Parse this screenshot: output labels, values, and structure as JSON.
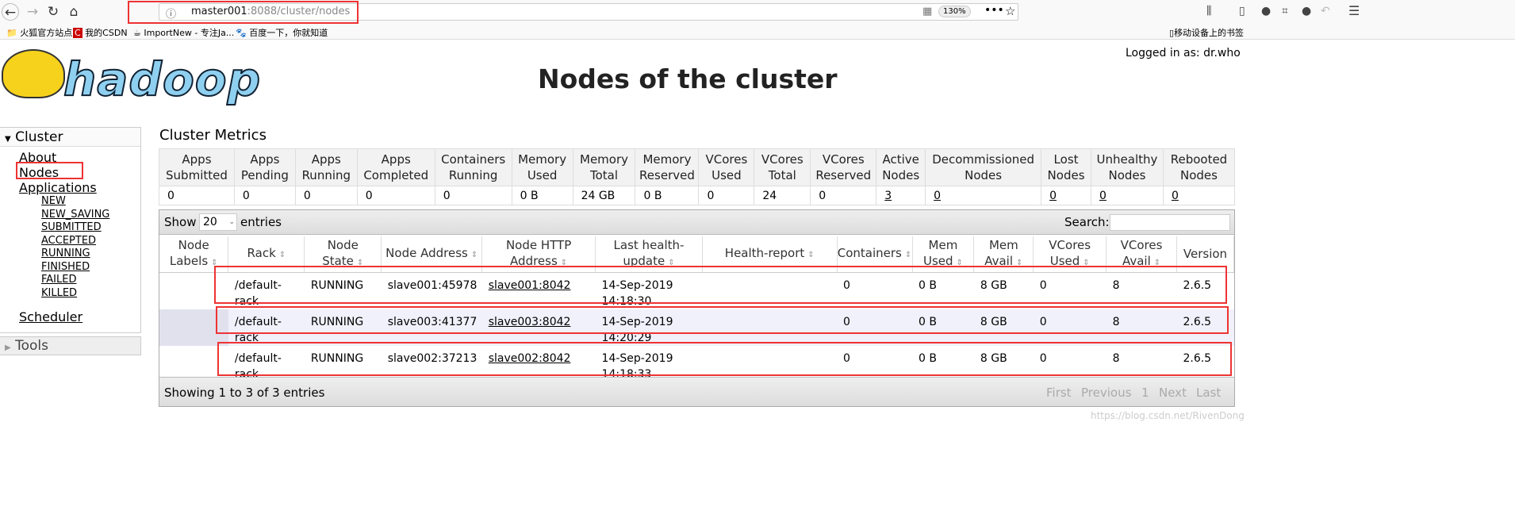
{
  "browser": {
    "url_host": "master001",
    "url_rest": ":8088/cluster/nodes",
    "zoom": "130%",
    "bookmarks": [
      "火狐官方站点",
      "我的CSDN",
      "ImportNew - 专注Ja...",
      "百度一下，你就知道"
    ],
    "mobile_bookmarks": "移动设备上的书签"
  },
  "header": {
    "title": "Nodes of the cluster",
    "logged_in": "Logged in as: dr.who",
    "logo_text": "hadoop"
  },
  "sidebar": {
    "cluster": "Cluster",
    "about": "About",
    "nodes": "Nodes",
    "applications": "Applications",
    "app_states": [
      "NEW",
      "NEW_SAVING",
      "SUBMITTED",
      "ACCEPTED",
      "RUNNING",
      "FINISHED",
      "FAILED",
      "KILLED"
    ],
    "scheduler": "Scheduler",
    "tools": "Tools"
  },
  "metrics": {
    "title": "Cluster Metrics",
    "headers": [
      [
        "Apps",
        "Submitted"
      ],
      [
        "Apps",
        "Pending"
      ],
      [
        "Apps",
        "Running"
      ],
      [
        "Apps",
        "Completed"
      ],
      [
        "Containers",
        "Running"
      ],
      [
        "Memory",
        "Used"
      ],
      [
        "Memory",
        "Total"
      ],
      [
        "Memory",
        "Reserved"
      ],
      [
        "VCores",
        "Used"
      ],
      [
        "VCores",
        "Total"
      ],
      [
        "VCores",
        "Reserved"
      ],
      [
        "Active",
        "Nodes"
      ],
      [
        "Decommissioned",
        "Nodes"
      ],
      [
        "Lost",
        "Nodes"
      ],
      [
        "Unhealthy",
        "Nodes"
      ],
      [
        "Rebooted",
        "Nodes"
      ]
    ],
    "values": [
      "0",
      "0",
      "0",
      "0",
      "0",
      "0 B",
      "24 GB",
      "0 B",
      "0",
      "24",
      "0",
      "3",
      "0",
      "0",
      "0",
      "0"
    ]
  },
  "nodes": {
    "show": "Show",
    "entries_value": "20",
    "entries": "entries",
    "search": "Search:",
    "headers": [
      [
        "Node",
        "Labels"
      ],
      [
        "Rack",
        ""
      ],
      [
        "Node",
        "State"
      ],
      [
        "Node Address",
        ""
      ],
      [
        "Node HTTP",
        "Address"
      ],
      [
        "Last health-",
        "update"
      ],
      [
        "Health-report",
        ""
      ],
      [
        "Containers",
        ""
      ],
      [
        "Mem",
        "Used"
      ],
      [
        "Mem",
        "Avail"
      ],
      [
        "VCores",
        "Used"
      ],
      [
        "VCores",
        "Avail"
      ],
      [
        "Version",
        ""
      ]
    ],
    "rows": [
      [
        "",
        "/default-rack",
        "RUNNING",
        "slave001:45978",
        "slave001:8042",
        "14-Sep-2019 14:18:30",
        "",
        "0",
        "0 B",
        "8 GB",
        "0",
        "8",
        "2.6.5"
      ],
      [
        "",
        "/default-rack",
        "RUNNING",
        "slave003:41377",
        "slave003:8042",
        "14-Sep-2019 14:20:29",
        "",
        "0",
        "0 B",
        "8 GB",
        "0",
        "8",
        "2.6.5"
      ],
      [
        "",
        "/default-rack",
        "RUNNING",
        "slave002:37213",
        "slave002:8042",
        "14-Sep-2019 14:18:33",
        "",
        "0",
        "0 B",
        "8 GB",
        "0",
        "8",
        "2.6.5"
      ]
    ],
    "showing": "Showing 1 to 3 of 3 entries",
    "pager": {
      "first": "First",
      "previous": "Previous",
      "page": "1",
      "next": "Next",
      "last": "Last"
    }
  },
  "watermark": "https://blog.csdn.net/RivenDong"
}
